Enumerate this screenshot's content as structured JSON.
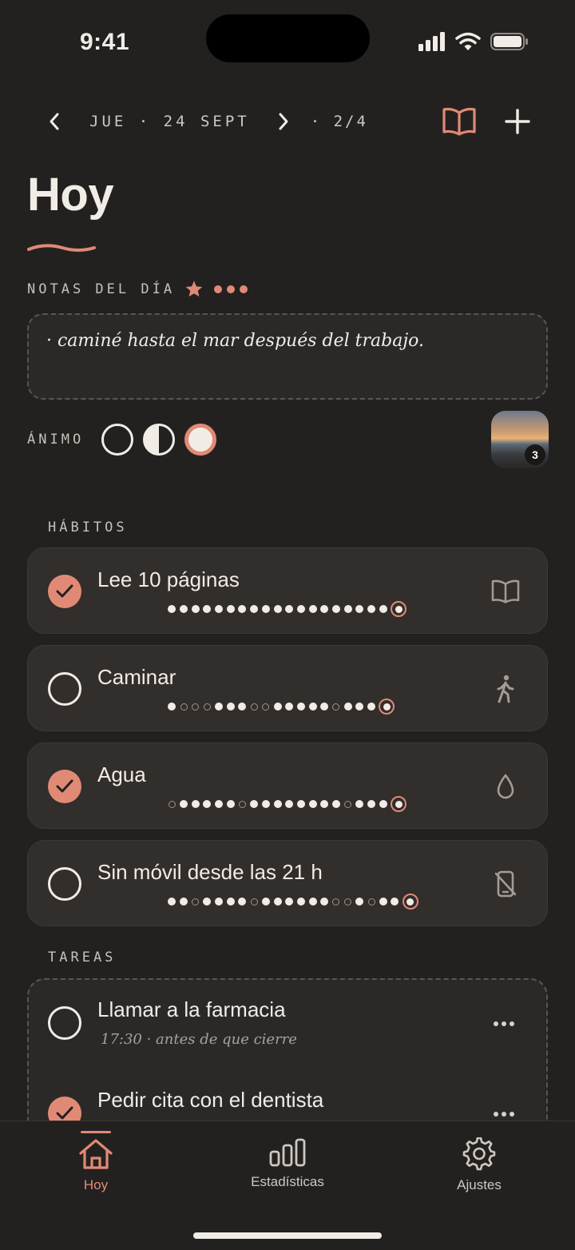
{
  "status": {
    "time": "9:41"
  },
  "header": {
    "date": "JUE · 24 SEPT",
    "page": "· 2/4",
    "title": "Hoy"
  },
  "notes": {
    "label": "NOTAS DEL DÍA",
    "text": "· caminé hasta el mar después del trabajo."
  },
  "mood": {
    "label": "ÁNIMO",
    "options": [
      "empty",
      "half",
      "full"
    ],
    "selected": 2
  },
  "photo": {
    "count": "3"
  },
  "habits": {
    "label": "HÁBITOS",
    "items": [
      {
        "name": "Lee 10 páginas",
        "done": true,
        "icon": "book-icon",
        "history": "fffffffffffffffffff"
      },
      {
        "name": "Caminar",
        "done": false,
        "icon": "walking-icon",
        "history": "feeefffeefffffefff"
      },
      {
        "name": "Agua",
        "done": true,
        "icon": "drop-icon",
        "history": "efffffeffffffffefff"
      },
      {
        "name": "Sin móvil desde las 21 h",
        "done": false,
        "icon": "no-phone-icon",
        "history": "ffeffffeffffffeefeff"
      }
    ]
  },
  "tasks": {
    "label": "TAREAS",
    "items": [
      {
        "title": "Llamar a la farmacia",
        "subtitle": "17:30 · antes de que cierre",
        "done": false
      },
      {
        "title": "Pedir cita con el dentista",
        "subtitle": "",
        "done": true
      }
    ]
  },
  "tabs": [
    {
      "label": "Hoy",
      "icon": "home-icon",
      "active": true
    },
    {
      "label": "Estadísticas",
      "icon": "stats-icon",
      "active": false
    },
    {
      "label": "Ajustes",
      "icon": "gear-icon",
      "active": false
    }
  ],
  "colors": {
    "accent": "#e08a76",
    "background": "#232120",
    "card": "#312e2c",
    "text": "#f2ece6"
  }
}
